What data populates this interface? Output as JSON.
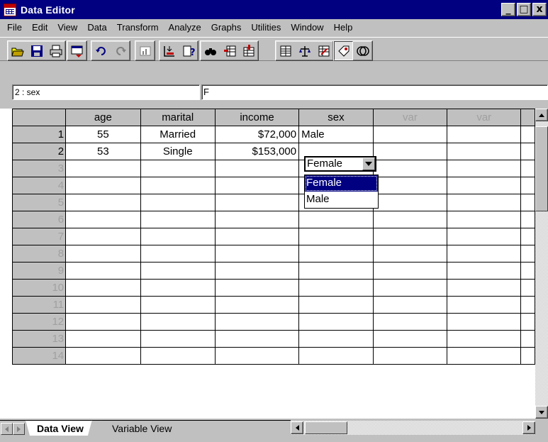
{
  "window": {
    "title": "Data Editor",
    "minimize": "_",
    "maximize": "□",
    "close": "x"
  },
  "menu": [
    "File",
    "Edit",
    "View",
    "Data",
    "Transform",
    "Analyze",
    "Graphs",
    "Utilities",
    "Window",
    "Help"
  ],
  "toolbar": {
    "icons": [
      "open-icon",
      "save-icon",
      "print-icon",
      "dialog-recall-icon",
      "undo-icon",
      "redo-icon",
      "goto-chart-icon",
      "goto-case-icon",
      "variables-icon",
      "find-icon",
      "insert-case-icon",
      "insert-variable-icon",
      "split-file-icon",
      "weight-cases-icon",
      "select-cases-icon",
      "value-labels-icon",
      "use-sets-icon"
    ]
  },
  "cell_editor": {
    "reference": "2 : sex",
    "value": "F"
  },
  "grid": {
    "columns": [
      "age",
      "marital",
      "income",
      "sex",
      "var",
      "var"
    ],
    "rows": [
      {
        "num": "1",
        "age": "55",
        "marital": "Married",
        "income": "$72,000",
        "sex": "Male"
      },
      {
        "num": "2",
        "age": "53",
        "marital": "Single",
        "income": "$153,000",
        "sex": "Female"
      },
      {
        "num": "3"
      },
      {
        "num": "4"
      },
      {
        "num": "5"
      },
      {
        "num": "6"
      },
      {
        "num": "7"
      },
      {
        "num": "8"
      },
      {
        "num": "9"
      },
      {
        "num": "10"
      },
      {
        "num": "11"
      },
      {
        "num": "12"
      },
      {
        "num": "13"
      },
      {
        "num": "14"
      }
    ]
  },
  "dropdown": {
    "current": "Female",
    "options": [
      "Female",
      "Male"
    ],
    "selected": "Female"
  },
  "tabs": {
    "data_view": "Data View",
    "variable_view": "Variable View"
  },
  "colors": {
    "titlebar": "#000080",
    "selection": "#000080",
    "chrome": "#c0c0c0"
  }
}
